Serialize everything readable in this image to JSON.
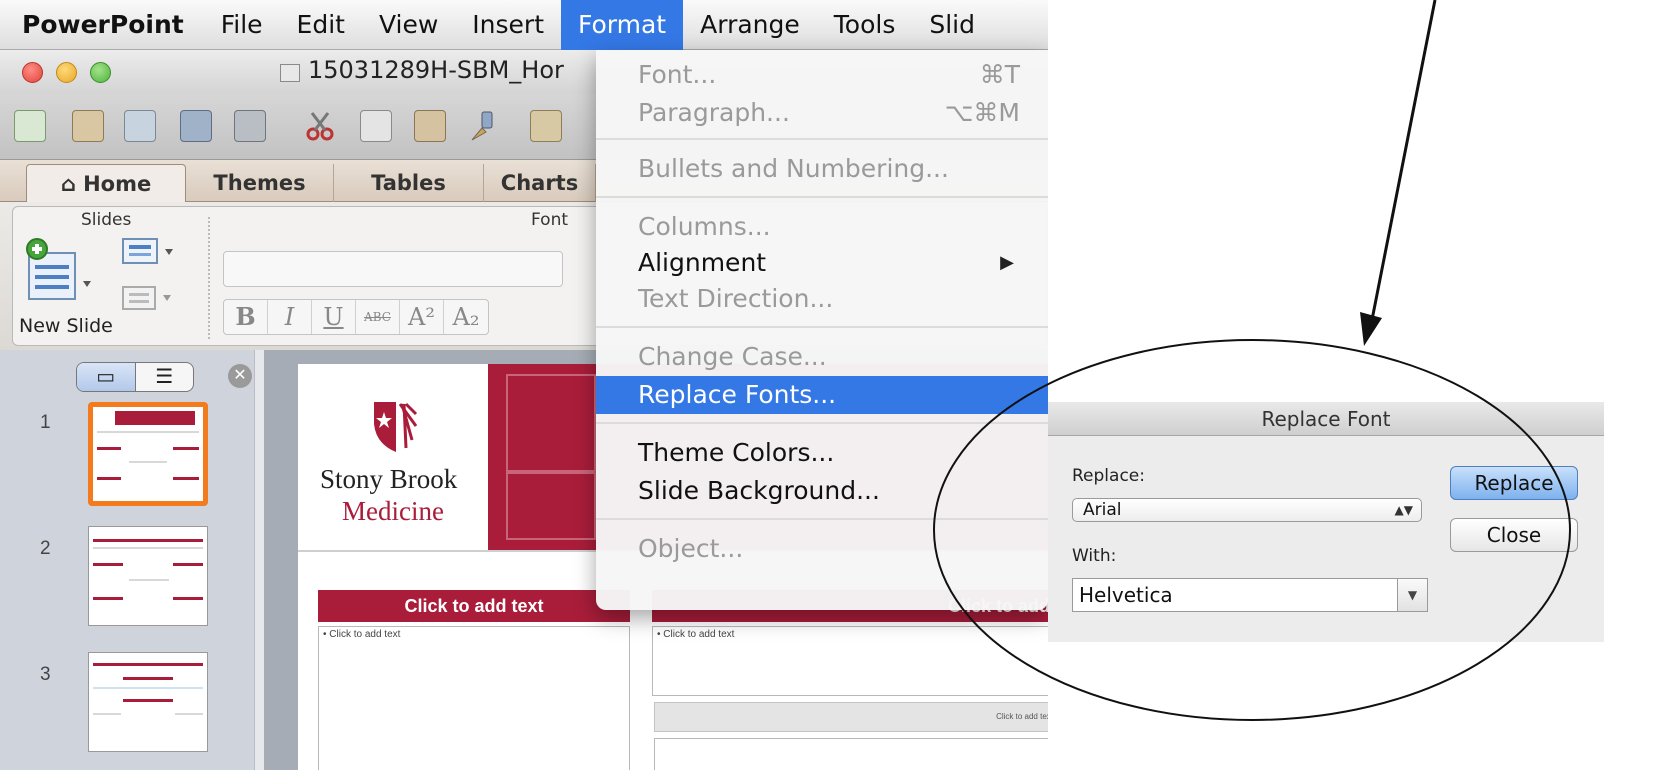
{
  "menubar": {
    "app": "PowerPoint",
    "items": [
      "File",
      "Edit",
      "View",
      "Insert",
      "Format",
      "Arrange",
      "Tools",
      "Slid"
    ],
    "active": "Format"
  },
  "window": {
    "title": "15031289H-SBM_Hor"
  },
  "ribbon": {
    "tabs": [
      "Home",
      "Themes",
      "Tables",
      "Charts"
    ],
    "active_tab": "Home",
    "home_icon": "home-icon",
    "group_slides": "Slides",
    "group_font": "Font",
    "new_slide": "New Slide",
    "format_buttons": [
      "B",
      "I",
      "U",
      "ABC",
      "A²",
      "A₂"
    ]
  },
  "format_menu": {
    "items": [
      {
        "label": "Font...",
        "shortcut": "⌘T",
        "enabled": false
      },
      {
        "label": "Paragraph...",
        "shortcut": "⌥⌘M",
        "enabled": false
      },
      {
        "label": "Bullets and Numbering...",
        "enabled": false
      },
      {
        "label": "Columns...",
        "enabled": false
      },
      {
        "label": "Alignment",
        "enabled": true,
        "submenu": true
      },
      {
        "label": "Text Direction...",
        "enabled": false
      },
      {
        "label": "Change Case...",
        "enabled": false
      },
      {
        "label": "Replace Fonts...",
        "enabled": true,
        "highlighted": true
      },
      {
        "label": "Theme Colors...",
        "enabled": true
      },
      {
        "label": "Slide Background...",
        "enabled": true
      },
      {
        "label": "Object...",
        "enabled": false
      }
    ],
    "submenu_arrow": "▶"
  },
  "slides_pane": {
    "slide_numbers": [
      "1",
      "2",
      "3"
    ],
    "selected": "1"
  },
  "slide": {
    "logo_line1": "Stony Brook",
    "logo_line2": "Medicine",
    "header_left": "Click to add text",
    "header_right": "Click to add",
    "body_left": "• Click to add text",
    "body_right": "• Click to add text",
    "small_bar": "Click to add text"
  },
  "dialog": {
    "title": "Replace Font",
    "replace_label": "Replace:",
    "replace_value": "Arial",
    "with_label": "With:",
    "with_value": "Helvetica",
    "replace_button": "Replace",
    "close_button": "Close"
  },
  "colors": {
    "menu_highlight": "#3478e6",
    "brand_red": "#a91d3a",
    "selected_slide_border": "#f37b1d"
  }
}
